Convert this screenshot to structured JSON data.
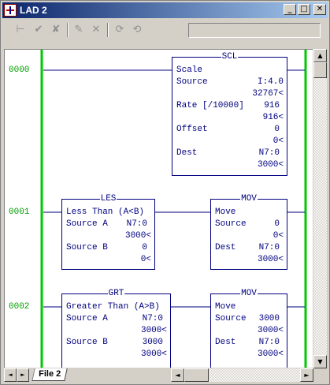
{
  "window": {
    "title": "LAD 2",
    "buttons": {
      "minimize": "_",
      "maximize": "□",
      "close": "✕"
    }
  },
  "toolbar": {
    "icons": [
      "insert-rung-icon",
      "accept-edits-icon",
      "cancel-edits-icon",
      "test-edits-icon",
      "delete-icon",
      "assemble-edits-icon",
      "undo-test-icon"
    ],
    "glyphs": [
      "⊢",
      "✔",
      "✘",
      "✎",
      "✕",
      "⟳",
      "⟲"
    ],
    "field_value": ""
  },
  "colors": {
    "rail": "#00c800",
    "block": "#000080",
    "rung_number": "#00a000"
  },
  "rungs": [
    {
      "number": "0000",
      "blocks": [
        {
          "mnemonic": "SCL",
          "description": "Scale",
          "rows": [
            {
              "label": "Source",
              "value": "I:4.0"
            },
            {
              "label": "",
              "value": "32767<"
            },
            {
              "label": "Rate [/10000]",
              "value": "916"
            },
            {
              "label": "",
              "value": "916<"
            },
            {
              "label": "Offset",
              "value": "0"
            },
            {
              "label": "",
              "value": "0<"
            },
            {
              "label": "Dest",
              "value": "N7:0"
            },
            {
              "label": "",
              "value": "3000<"
            }
          ]
        }
      ]
    },
    {
      "number": "0001",
      "blocks": [
        {
          "mnemonic": "LES",
          "description": "Less Than (A<B)",
          "rows": [
            {
              "label": "Source A",
              "value": "N7:0"
            },
            {
              "label": "",
              "value": "3000<"
            },
            {
              "label": "Source B",
              "value": "0"
            },
            {
              "label": "",
              "value": "0<"
            }
          ]
        },
        {
          "mnemonic": "MOV",
          "description": "Move",
          "rows": [
            {
              "label": "Source",
              "value": "0"
            },
            {
              "label": "",
              "value": "0<"
            },
            {
              "label": "Dest",
              "value": "N7:0"
            },
            {
              "label": "",
              "value": "3000<"
            }
          ]
        }
      ]
    },
    {
      "number": "0002",
      "blocks": [
        {
          "mnemonic": "GRT",
          "description": "Greater Than (A>B)",
          "rows": [
            {
              "label": "Source A",
              "value": "N7:0"
            },
            {
              "label": "",
              "value": "3000<"
            },
            {
              "label": "Source B",
              "value": "3000"
            },
            {
              "label": "",
              "value": "3000<"
            }
          ]
        },
        {
          "mnemonic": "MOV",
          "description": "Move",
          "rows": [
            {
              "label": "Source",
              "value": "3000"
            },
            {
              "label": "",
              "value": "3000<"
            },
            {
              "label": "Dest",
              "value": "N7:0"
            },
            {
              "label": "",
              "value": "3000<"
            }
          ]
        }
      ]
    }
  ],
  "tabs": [
    {
      "label": "File 2"
    }
  ],
  "scrollbar": {
    "up": "▲",
    "down": "▼",
    "left": "◄",
    "right": "►",
    "first": "|◄",
    "last": "►|"
  }
}
